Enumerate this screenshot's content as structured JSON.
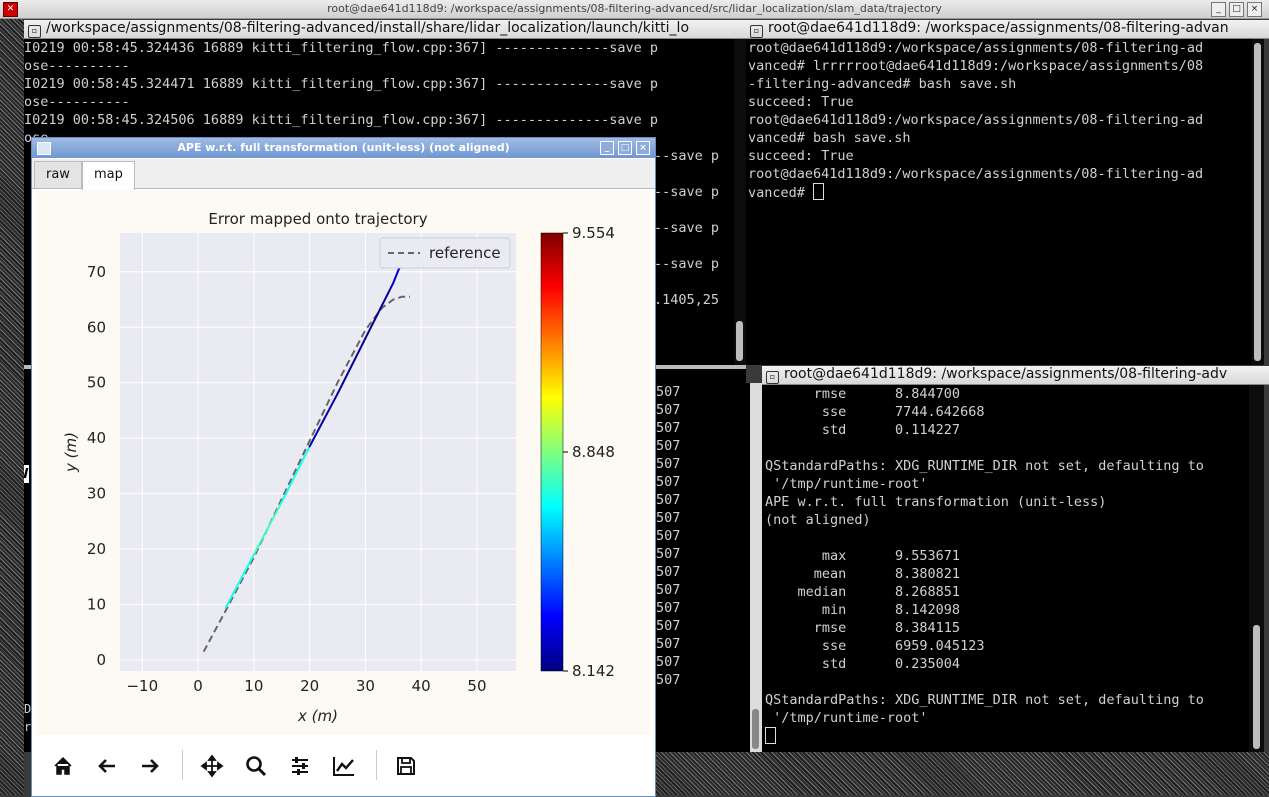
{
  "main_window": {
    "title": "root@dae641d118d9: /workspace/assignments/08-filtering-advanced/src/lidar_localization/slam_data/trajectory",
    "min": "_",
    "max": "□",
    "close": "×"
  },
  "left_terminal": {
    "tab_title": "/workspace/assignments/08-filtering-advanced/install/share/lidar_localization/launch/kitti_lo",
    "lines": [
      "I0219 00:58:45.324436 16889 kitti_filtering_flow.cpp:367] --------------save p",
      "ose----------",
      "I0219 00:58:45.324471 16889 kitti_filtering_flow.cpp:367] --------------save p",
      "ose----------",
      "I0219 00:58:45.324506 16889 kitti_filtering_flow.cpp:367] --------------save p",
      "ose----------"
    ],
    "partial_lines": [
      "--save p",
      "",
      "--save p",
      "",
      "--save p",
      "",
      "--save p",
      "",
      ".1405,25"
    ]
  },
  "right_top_terminal": {
    "tab_title": "root@dae641d118d9: /workspace/assignments/08-filtering-advan",
    "lines": [
      "root@dae641d118d9:/workspace/assignments/08-filtering-ad",
      "vanced# lrrrrroot@dae641d118d9:/workspace/assignments/08",
      "-filtering-advanced# bash save.sh",
      "succeed: True",
      "root@dae641d118d9:/workspace/assignments/08-filtering-ad",
      "vanced# bash save.sh",
      "succeed: True",
      "root@dae641d118d9:/workspace/assignments/08-filtering-ad",
      "vanced# "
    ]
  },
  "mid_terminal": {
    "lines": [
      "507",
      "507",
      "507",
      "507",
      "507",
      "507",
      "507",
      "507",
      "507",
      "507",
      "507",
      "507",
      "507",
      "507",
      "507",
      "507",
      "507"
    ]
  },
  "right_bottom_terminal": {
    "tab_title": "root@dae641d118d9: /workspace/assignments/08-filtering-adv",
    "lines": [
      "      rmse      8.844700",
      "       sse      7744.642668",
      "       std      0.114227",
      "",
      "QStandardPaths: XDG_RUNTIME_DIR not set, defaulting to",
      " '/tmp/runtime-root'",
      "APE w.r.t. full transformation (unit-less)",
      "(not aligned)",
      "",
      "       max      9.553671",
      "      mean      8.380821",
      "    median      8.268851",
      "       min      8.142098",
      "      rmse      8.384115",
      "       sse      6959.045123",
      "       std      0.235004",
      "",
      "QStandardPaths: XDG_RUNTIME_DIR not set, defaulting to",
      " '/tmp/runtime-root'"
    ]
  },
  "left_edge_fragments": [
    "e W",
    "D",
    "r"
  ],
  "plot_window": {
    "title": "APE w.r.t. full transformation (unit-less) (not aligned)",
    "tabs": [
      {
        "label": "raw"
      },
      {
        "label": "map"
      }
    ],
    "active_tab": "map"
  },
  "chart_data": {
    "type": "line",
    "title": "Error mapped onto trajectory",
    "xlabel": "x (m)",
    "ylabel": "y (m)",
    "xlim": [
      -14,
      57
    ],
    "ylim": [
      -2,
      77
    ],
    "xticks": [
      -10,
      0,
      10,
      20,
      30,
      40,
      50
    ],
    "yticks": [
      0,
      10,
      20,
      30,
      40,
      50,
      60,
      70
    ],
    "legend": {
      "entries": [
        "reference"
      ],
      "placement": "top-right"
    },
    "colorbar": {
      "min": 8.142,
      "mid": 8.848,
      "max": 9.554,
      "labels": [
        "9.554",
        "8.848",
        "8.142"
      ],
      "colormap": "jet"
    },
    "series": [
      {
        "name": "reference",
        "style": "dashed",
        "color": "#666666",
        "x": [
          1.0,
          5.0,
          10.0,
          15.0,
          20.0,
          25.0,
          30.0,
          33.0,
          35.0,
          36.5,
          38.0
        ],
        "y": [
          1.5,
          9.0,
          18.5,
          29.0,
          39.5,
          50.0,
          59.5,
          63.5,
          65.0,
          65.5,
          65.5
        ]
      },
      {
        "style": "error-colored",
        "x": [
          5.0,
          10.0,
          15.0,
          20.0,
          25.0,
          30.0,
          33.0,
          35.0,
          36.0,
          37.0,
          38.0
        ],
        "y": [
          9.5,
          19.0,
          28.5,
          38.5,
          48.0,
          58.0,
          64.0,
          68.0,
          70.5,
          72.0,
          73.0
        ],
        "error": [
          8.7,
          8.75,
          8.7,
          8.2,
          8.18,
          8.16,
          8.2,
          8.25,
          8.3,
          8.35,
          8.4
        ]
      }
    ]
  },
  "toolbar": {
    "buttons": [
      "home-icon",
      "back-icon",
      "forward-icon",
      "pan-icon",
      "zoom-icon",
      "configure-subplots-icon",
      "edit-axis-icon",
      "save-icon"
    ]
  }
}
